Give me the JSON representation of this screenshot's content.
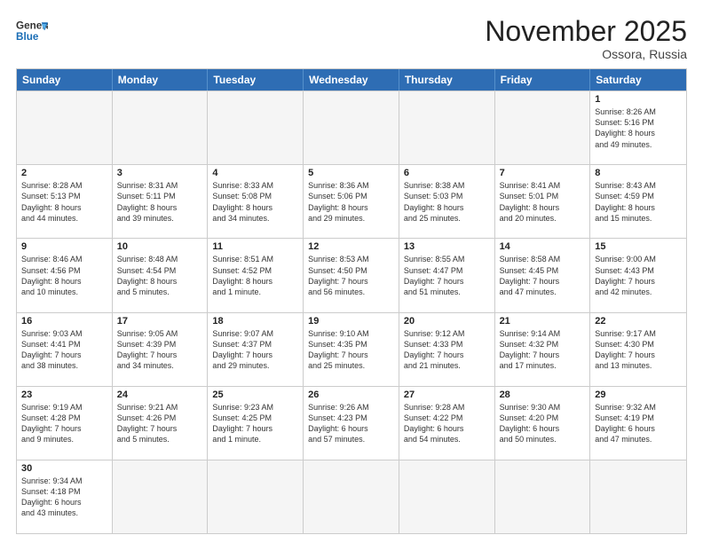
{
  "header": {
    "logo_general": "General",
    "logo_blue": "Blue",
    "month_title": "November 2025",
    "location": "Ossora, Russia"
  },
  "weekdays": [
    "Sunday",
    "Monday",
    "Tuesday",
    "Wednesday",
    "Thursday",
    "Friday",
    "Saturday"
  ],
  "rows": [
    [
      {
        "day": "",
        "info": "",
        "empty": true
      },
      {
        "day": "",
        "info": "",
        "empty": true
      },
      {
        "day": "",
        "info": "",
        "empty": true
      },
      {
        "day": "",
        "info": "",
        "empty": true
      },
      {
        "day": "",
        "info": "",
        "empty": true
      },
      {
        "day": "",
        "info": "",
        "empty": true
      },
      {
        "day": "1",
        "info": "Sunrise: 8:26 AM\nSunset: 5:16 PM\nDaylight: 8 hours\nand 49 minutes.",
        "empty": false
      }
    ],
    [
      {
        "day": "2",
        "info": "Sunrise: 8:28 AM\nSunset: 5:13 PM\nDaylight: 8 hours\nand 44 minutes.",
        "empty": false
      },
      {
        "day": "3",
        "info": "Sunrise: 8:31 AM\nSunset: 5:11 PM\nDaylight: 8 hours\nand 39 minutes.",
        "empty": false
      },
      {
        "day": "4",
        "info": "Sunrise: 8:33 AM\nSunset: 5:08 PM\nDaylight: 8 hours\nand 34 minutes.",
        "empty": false
      },
      {
        "day": "5",
        "info": "Sunrise: 8:36 AM\nSunset: 5:06 PM\nDaylight: 8 hours\nand 29 minutes.",
        "empty": false
      },
      {
        "day": "6",
        "info": "Sunrise: 8:38 AM\nSunset: 5:03 PM\nDaylight: 8 hours\nand 25 minutes.",
        "empty": false
      },
      {
        "day": "7",
        "info": "Sunrise: 8:41 AM\nSunset: 5:01 PM\nDaylight: 8 hours\nand 20 minutes.",
        "empty": false
      },
      {
        "day": "8",
        "info": "Sunrise: 8:43 AM\nSunset: 4:59 PM\nDaylight: 8 hours\nand 15 minutes.",
        "empty": false
      }
    ],
    [
      {
        "day": "9",
        "info": "Sunrise: 8:46 AM\nSunset: 4:56 PM\nDaylight: 8 hours\nand 10 minutes.",
        "empty": false
      },
      {
        "day": "10",
        "info": "Sunrise: 8:48 AM\nSunset: 4:54 PM\nDaylight: 8 hours\nand 5 minutes.",
        "empty": false
      },
      {
        "day": "11",
        "info": "Sunrise: 8:51 AM\nSunset: 4:52 PM\nDaylight: 8 hours\nand 1 minute.",
        "empty": false
      },
      {
        "day": "12",
        "info": "Sunrise: 8:53 AM\nSunset: 4:50 PM\nDaylight: 7 hours\nand 56 minutes.",
        "empty": false
      },
      {
        "day": "13",
        "info": "Sunrise: 8:55 AM\nSunset: 4:47 PM\nDaylight: 7 hours\nand 51 minutes.",
        "empty": false
      },
      {
        "day": "14",
        "info": "Sunrise: 8:58 AM\nSunset: 4:45 PM\nDaylight: 7 hours\nand 47 minutes.",
        "empty": false
      },
      {
        "day": "15",
        "info": "Sunrise: 9:00 AM\nSunset: 4:43 PM\nDaylight: 7 hours\nand 42 minutes.",
        "empty": false
      }
    ],
    [
      {
        "day": "16",
        "info": "Sunrise: 9:03 AM\nSunset: 4:41 PM\nDaylight: 7 hours\nand 38 minutes.",
        "empty": false
      },
      {
        "day": "17",
        "info": "Sunrise: 9:05 AM\nSunset: 4:39 PM\nDaylight: 7 hours\nand 34 minutes.",
        "empty": false
      },
      {
        "day": "18",
        "info": "Sunrise: 9:07 AM\nSunset: 4:37 PM\nDaylight: 7 hours\nand 29 minutes.",
        "empty": false
      },
      {
        "day": "19",
        "info": "Sunrise: 9:10 AM\nSunset: 4:35 PM\nDaylight: 7 hours\nand 25 minutes.",
        "empty": false
      },
      {
        "day": "20",
        "info": "Sunrise: 9:12 AM\nSunset: 4:33 PM\nDaylight: 7 hours\nand 21 minutes.",
        "empty": false
      },
      {
        "day": "21",
        "info": "Sunrise: 9:14 AM\nSunset: 4:32 PM\nDaylight: 7 hours\nand 17 minutes.",
        "empty": false
      },
      {
        "day": "22",
        "info": "Sunrise: 9:17 AM\nSunset: 4:30 PM\nDaylight: 7 hours\nand 13 minutes.",
        "empty": false
      }
    ],
    [
      {
        "day": "23",
        "info": "Sunrise: 9:19 AM\nSunset: 4:28 PM\nDaylight: 7 hours\nand 9 minutes.",
        "empty": false
      },
      {
        "day": "24",
        "info": "Sunrise: 9:21 AM\nSunset: 4:26 PM\nDaylight: 7 hours\nand 5 minutes.",
        "empty": false
      },
      {
        "day": "25",
        "info": "Sunrise: 9:23 AM\nSunset: 4:25 PM\nDaylight: 7 hours\nand 1 minute.",
        "empty": false
      },
      {
        "day": "26",
        "info": "Sunrise: 9:26 AM\nSunset: 4:23 PM\nDaylight: 6 hours\nand 57 minutes.",
        "empty": false
      },
      {
        "day": "27",
        "info": "Sunrise: 9:28 AM\nSunset: 4:22 PM\nDaylight: 6 hours\nand 54 minutes.",
        "empty": false
      },
      {
        "day": "28",
        "info": "Sunrise: 9:30 AM\nSunset: 4:20 PM\nDaylight: 6 hours\nand 50 minutes.",
        "empty": false
      },
      {
        "day": "29",
        "info": "Sunrise: 9:32 AM\nSunset: 4:19 PM\nDaylight: 6 hours\nand 47 minutes.",
        "empty": false
      }
    ],
    [
      {
        "day": "30",
        "info": "Sunrise: 9:34 AM\nSunset: 4:18 PM\nDaylight: 6 hours\nand 43 minutes.",
        "empty": false
      },
      {
        "day": "",
        "info": "",
        "empty": true
      },
      {
        "day": "",
        "info": "",
        "empty": true
      },
      {
        "day": "",
        "info": "",
        "empty": true
      },
      {
        "day": "",
        "info": "",
        "empty": true
      },
      {
        "day": "",
        "info": "",
        "empty": true
      },
      {
        "day": "",
        "info": "",
        "empty": true
      }
    ]
  ]
}
